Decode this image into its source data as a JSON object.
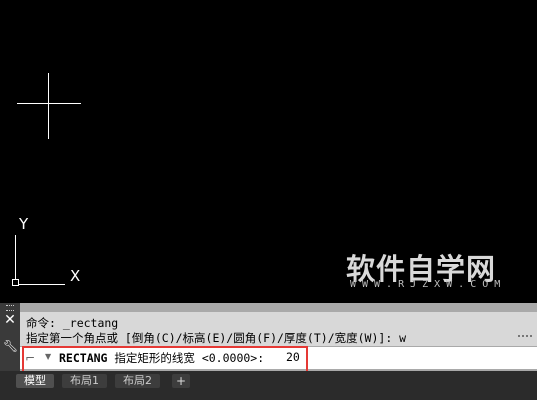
{
  "viewport": {
    "ucs_y_label": "Y",
    "ucs_x_label": "X",
    "watermark": {
      "title": "软件自学网",
      "subtitle": "WWW.RJZXW.COM"
    }
  },
  "command_line": {
    "history": [
      "命令: _rectang",
      "指定第一个角点或 [倒角(C)/标高(E)/圆角(F)/厚度(T)/宽度(W)]: w"
    ],
    "input": {
      "command_name": "RECTANG",
      "prompt": "指定矩形的线宽 <0.0000>:",
      "value": "20"
    },
    "highlight_color": "#e53935"
  },
  "tabs": [
    {
      "label": "模型",
      "active": true
    },
    {
      "label": "布局1",
      "active": false
    },
    {
      "label": "布局2",
      "active": false
    }
  ],
  "tab_add_label": "+",
  "icons": {
    "close": "close-icon",
    "wrench": "wrench-icon",
    "prompt": "command-prompt-icon"
  }
}
